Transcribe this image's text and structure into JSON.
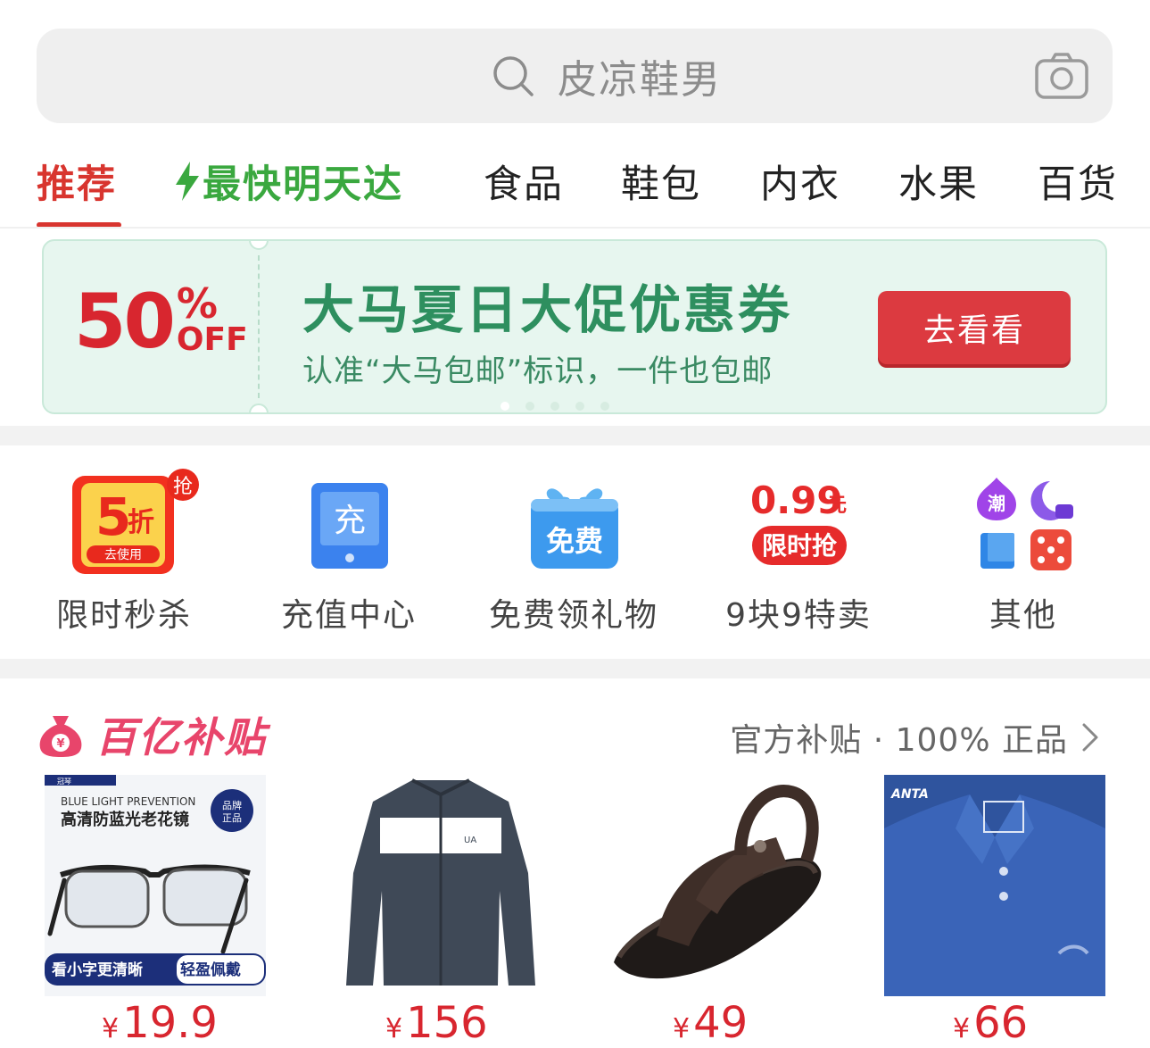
{
  "search": {
    "placeholder": "皮凉鞋男"
  },
  "tabs": [
    {
      "label": "推荐",
      "active": true
    },
    {
      "label": "最快明天达",
      "accent": "#3aa83f"
    },
    {
      "label": "食品"
    },
    {
      "label": "鞋包"
    },
    {
      "label": "内衣"
    },
    {
      "label": "水果"
    },
    {
      "label": "百货"
    }
  ],
  "banner": {
    "discount_number": "50",
    "discount_percent": "%",
    "discount_word": "OFF",
    "title": "大马夏日大促优惠券",
    "subtitle": "认准“大马包邮”标识，一件也包邮",
    "button": "去看看",
    "page_count": 5,
    "current_page": 1
  },
  "shortcuts": [
    {
      "label": "限时秒杀",
      "icon": "flash-sale-icon",
      "badge": "抢",
      "big": "5",
      "unit": "折",
      "sub": "去使用"
    },
    {
      "label": "充值中心",
      "icon": "recharge-icon",
      "glyph": "充"
    },
    {
      "label": "免费领礼物",
      "icon": "gift-icon",
      "glyph": "免费"
    },
    {
      "label": "9块9特卖",
      "icon": "price-tag-icon",
      "price": "0.99",
      "unit": "元",
      "tag": "限时抢"
    },
    {
      "label": "其他",
      "icon": "more-apps-icon",
      "chao": "潮"
    }
  ],
  "subsidy": {
    "title": "百亿补贴",
    "tag": "官方补贴 · 100% 正品"
  },
  "products": [
    {
      "name": "glasses",
      "price": "19.9",
      "currency": "¥",
      "top_text": "BLUE LIGHT PREVENTION",
      "title": "高清防蓝光老花镜",
      "badge": "品牌正品",
      "bottom_left": "看小字更清晰",
      "bottom_right": "轻盈佩戴",
      "corner": "冠琴"
    },
    {
      "name": "jacket",
      "price": "156",
      "currency": "¥"
    },
    {
      "name": "sandals",
      "price": "49",
      "currency": "¥"
    },
    {
      "name": "polo-shirt",
      "price": "66",
      "currency": "¥",
      "brand": "ANTA"
    }
  ],
  "colors": {
    "primary_red": "#d8352f",
    "green": "#3aa83f",
    "subsidy_pink": "#e8456b",
    "banner_green": "#2e8f5f"
  }
}
